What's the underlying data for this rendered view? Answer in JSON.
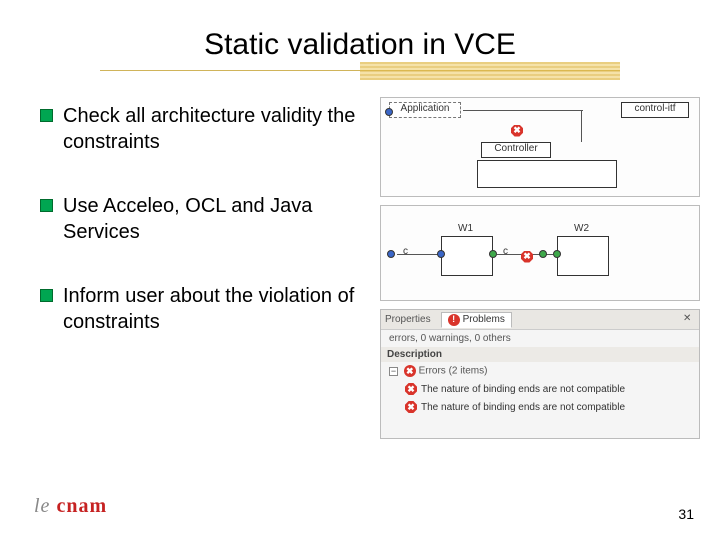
{
  "title": "Static validation in VCE",
  "bullets": [
    "Check all architecture validity the constraints",
    "Use Acceleo, OCL and Java Services",
    "Inform user about the violation of constraints"
  ],
  "diagram_top": {
    "left_box": "Application",
    "right_box": "control-itf",
    "bottom_box": "Controller"
  },
  "diagram_mid": {
    "port_c_left": "c",
    "box_w1": "W1",
    "port_c_mid": "c",
    "box_w2": "W2"
  },
  "panel": {
    "tab_properties": "Properties",
    "tab_problems": "Problems",
    "summary": "errors, 0 warnings, 0 others",
    "col_desc": "Description",
    "errors_group": "Errors (2 items)",
    "error_msg": "The nature of binding ends are not compatible"
  },
  "logo": {
    "le": "le ",
    "cnam": "cnam"
  },
  "page_number": "31"
}
